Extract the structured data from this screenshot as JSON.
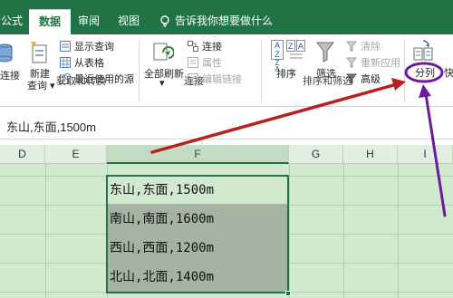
{
  "tabs": {
    "formula": "公式",
    "data": "数据",
    "review": "审阅",
    "view": "视图"
  },
  "tell_me": "告诉我你想要做什么",
  "ribbon": {
    "connect_label": "连接",
    "new_query": {
      "line1": "新建",
      "line2": "查询"
    },
    "show_query": "显示查询",
    "from_table": "从表格",
    "recent_sources": "最近使用的源",
    "group_get_transform": "获取和转换",
    "refresh_all": "全部刷新",
    "connections": "连接",
    "properties": "属性",
    "edit_links": "编辑链接",
    "group_connections": "连接",
    "sort_az_top": "A",
    "sort_az_bottom": "Z",
    "sort_za": {
      "top": "Z",
      "mid": "A",
      "bottom": "A"
    },
    "sort": "排序",
    "filter": "筛选",
    "clear": "清除",
    "reapply": "重新应用",
    "advanced": "高级",
    "group_sort_filter": "排序和筛选",
    "split": "分列",
    "fast": "快"
  },
  "formula_bar": {
    "value": "东山,东面,1500m"
  },
  "columns": {
    "d": "D",
    "e": "E",
    "f": "F",
    "g": "G",
    "h": "H",
    "i": "I"
  },
  "cells": [
    "东山,东面,1500m",
    "南山,南面,1600m",
    "西山,西面,1200m",
    "北山,北面,1400m"
  ],
  "colors": {
    "accent": "#217346",
    "annotation_red": "#b8201e",
    "annotation_purple": "#6d1a9c"
  }
}
